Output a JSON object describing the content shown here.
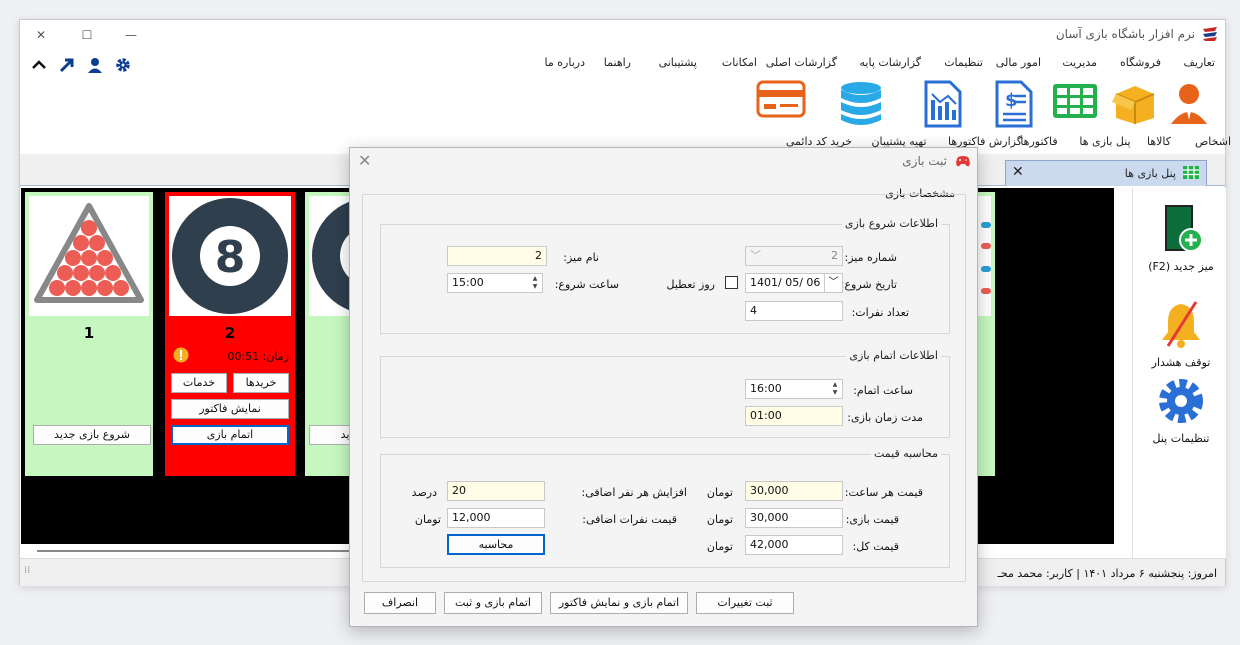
{
  "app": {
    "title": "نرم افزار باشگاه بازی آسان",
    "minimize": "—",
    "maximize": "☐",
    "close": "✕"
  },
  "menu": [
    "تعاریف",
    "فروشگاه",
    "مدیریت",
    "امور مالی",
    "تنظیمات",
    "گزارشات پایه",
    "گزارشات اصلی",
    "امکانات",
    "پشتیبانی",
    "راهنما",
    "درباره ما"
  ],
  "ribbon": {
    "persons": "اشخاص",
    "goods": "کالاها",
    "game_panel": "پنل بازی ها",
    "invoices": "فاکتورها",
    "invoice_report": "گزارش فاکتورها",
    "backup": "تهیه پشتیبان",
    "buy_code": "خرید کد دائمی"
  },
  "tab": {
    "label": "پنل بازی ها",
    "close": "✕"
  },
  "cards": [
    {
      "number": "1",
      "start_button": "شروع بازی جدید"
    },
    {
      "number": "2",
      "time_text": "زمان: 00:51",
      "services": "خدمات",
      "purchases": "خریدها",
      "show_invoice": "نمایش فاکتور",
      "finish_game": "اتمام بازی"
    },
    {
      "partial_button": "جدید"
    }
  ],
  "right_panel": {
    "new_table": "میز جدید (F2)",
    "stop_alarm": "توقف هشدار",
    "panel_settings": "تنظیمات پنل"
  },
  "status": {
    "text": "امروز: پنجشنبه ۶ مرداد ۱۴۰۱  |  کاربر: محمد محـ"
  },
  "dialog": {
    "title": "ثبت بازی",
    "close": "✕",
    "section_game": "مشخصات بازی",
    "group_start": "اطلاعات شروع بازی",
    "table_number_label": "شماره میز:",
    "table_number": "2",
    "table_name_label": "نام میز:",
    "table_name": "2",
    "start_date_label": "تاریخ شروع:",
    "start_date": "1401/ 05/ 06",
    "holiday_label": "روز تعطیل",
    "start_time_label": "ساعت شروع:",
    "start_time": "15:00",
    "people_label": "تعداد نفرات:",
    "people": "4",
    "group_end": "اطلاعات اتمام بازی",
    "end_time_label": "ساعت اتمام:",
    "end_time": "16:00",
    "duration_label": "مدت زمان بازی:",
    "duration": "01:00",
    "group_price": "محاسبه قیمت",
    "hourly_price_label": "قیمت هر ساعت:",
    "hourly_price": "30,000",
    "toman": "تومان",
    "extra_person_increase_label": "افزایش هر نفر اضافی:",
    "extra_person_increase": "20",
    "percent": "درصد",
    "game_price_label": "قیمت بازی:",
    "game_price": "30,000",
    "extra_people_price_label": "قیمت نفرات اضافی:",
    "extra_people_price": "12,000",
    "total_price_label": "قیمت کل:",
    "total_price": "42,000",
    "calculate": "محاسبه",
    "save_changes": "ثبت تغییرات",
    "finish_show_invoice": "اتمام بازی و نمایش فاکتور",
    "finish_save": "اتمام بازی و ثبت",
    "cancel": "انصراف"
  },
  "colors": {
    "card_green": "#c6f7c0",
    "card_red": "#ff0000",
    "field_yellow": "#fffde6",
    "accent_blue": "#0b3d91"
  }
}
